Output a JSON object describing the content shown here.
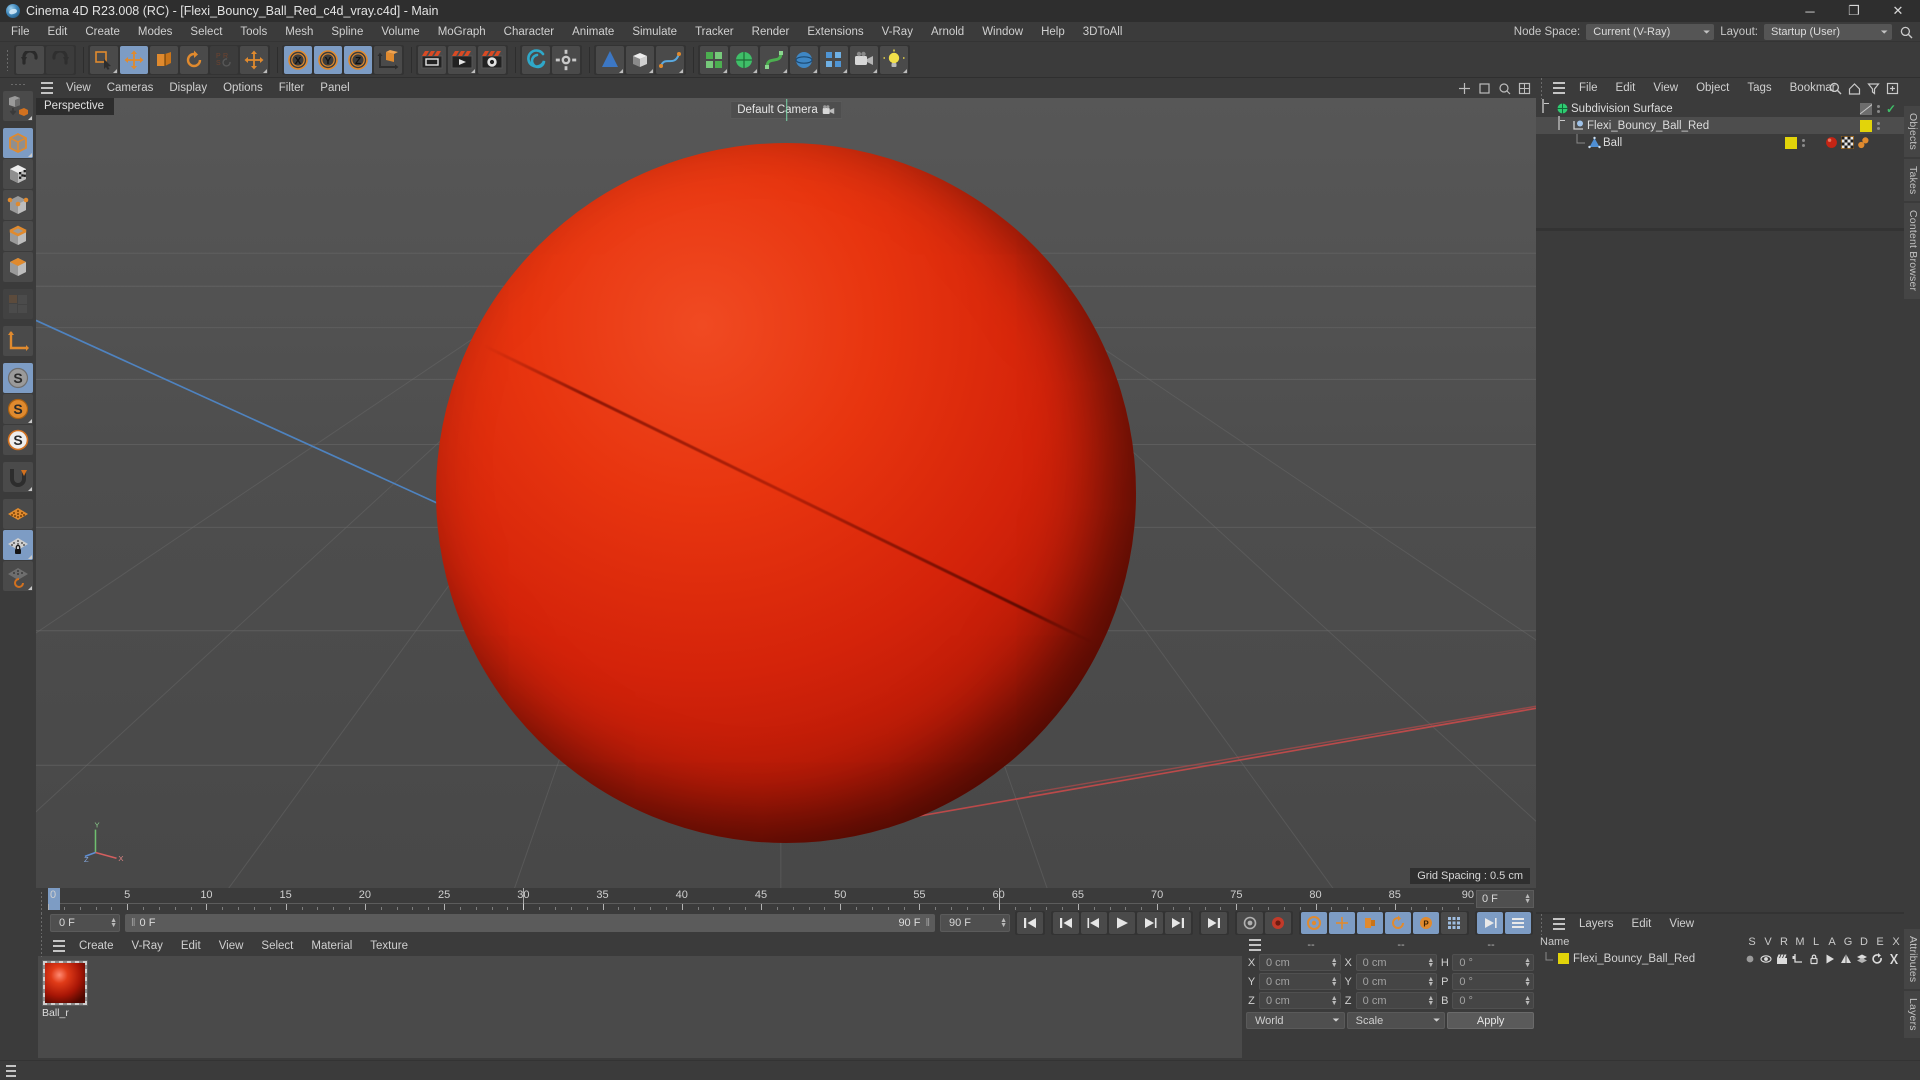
{
  "window": {
    "title": "Cinema 4D R23.008 (RC) - [Flexi_Bouncy_Ball_Red_c4d_vray.c4d] - Main",
    "minimize": "─",
    "maximize": "❐",
    "close": "✕"
  },
  "menubar": {
    "items": [
      "File",
      "Edit",
      "Create",
      "Modes",
      "Select",
      "Tools",
      "Mesh",
      "Spline",
      "Volume",
      "MoGraph",
      "Character",
      "Animate",
      "Simulate",
      "Tracker",
      "Render",
      "Extensions",
      "V-Ray",
      "Arnold",
      "Window",
      "Help",
      "3DToAll"
    ],
    "node_space_label": "Node Space:",
    "node_space_value": "Current (V-Ray)",
    "layout_label": "Layout:",
    "layout_value": "Startup (User)",
    "search_icon": "search-icon"
  },
  "toolbar": {
    "groups": [
      {
        "buttons": [
          {
            "name": "undo-button",
            "icon": "undo-arrow",
            "state": "normal"
          },
          {
            "name": "redo-button",
            "icon": "redo-arrow",
            "state": "disabled"
          }
        ]
      },
      {
        "buttons": [
          {
            "name": "live-selection-button",
            "icon": "selection-cursor",
            "state": "normal"
          },
          {
            "name": "move-tool-button",
            "icon": "move-axis",
            "state": "active"
          },
          {
            "name": "scale-tool-button",
            "icon": "scale-box",
            "state": "normal"
          },
          {
            "name": "rotate-tool-button",
            "icon": "rotate-ring",
            "state": "normal"
          },
          {
            "name": "psr-button",
            "icon": "psr-text",
            "state": "disabled"
          },
          {
            "name": "move-alt-button",
            "icon": "move-axis",
            "state": "normal"
          }
        ]
      },
      {
        "buttons": [
          {
            "name": "x-axis-lock-button",
            "icon": "axis-x",
            "state": "active"
          },
          {
            "name": "y-axis-lock-button",
            "icon": "axis-y",
            "state": "active"
          },
          {
            "name": "z-axis-lock-button",
            "icon": "axis-z",
            "state": "active"
          },
          {
            "name": "world-object-axis-button",
            "icon": "world-cube",
            "state": "normal"
          }
        ]
      },
      {
        "buttons": [
          {
            "name": "render-view-button",
            "icon": "render-clapper",
            "state": "normal"
          },
          {
            "name": "render-to-picture-viewer-button",
            "icon": "render-play-clapper",
            "state": "normal"
          },
          {
            "name": "render-settings-button",
            "icon": "render-gear-clapper",
            "state": "normal"
          }
        ]
      },
      {
        "buttons": [
          {
            "name": "vray-render-button",
            "icon": "vray-swirl",
            "state": "normal"
          },
          {
            "name": "vray-settings-button",
            "icon": "vray-gear",
            "state": "normal"
          }
        ]
      },
      {
        "buttons": [
          {
            "name": "add-primitive-button",
            "icon": "cone-primitive",
            "state": "normal"
          },
          {
            "name": "add-cube-button",
            "icon": "cube-primitive",
            "state": "normal"
          },
          {
            "name": "add-spline-button",
            "icon": "spline-pen",
            "state": "normal"
          }
        ]
      },
      {
        "buttons": [
          {
            "name": "generator-button",
            "icon": "green-array",
            "state": "normal"
          },
          {
            "name": "subdivision-surface-button",
            "icon": "green-subdiv",
            "state": "normal"
          },
          {
            "name": "deformer-button",
            "icon": "green-deformer",
            "state": "normal"
          },
          {
            "name": "scene-object-button",
            "icon": "blue-scene",
            "state": "normal"
          },
          {
            "name": "mograph-button",
            "icon": "blue-mograph",
            "state": "normal"
          },
          {
            "name": "camera-button",
            "icon": "camera",
            "state": "normal"
          },
          {
            "name": "light-button",
            "icon": "light-bulb",
            "state": "normal"
          }
        ]
      }
    ]
  },
  "left_toolbar": {
    "buttons": [
      {
        "name": "make-editable-button",
        "icon": "make-editable",
        "state": "normal"
      },
      {
        "name": "model-mode-button",
        "icon": "model-cube",
        "state": "active"
      },
      {
        "name": "texture-mode-button",
        "icon": "texture-cube",
        "state": "normal"
      },
      {
        "name": "points-mode-button",
        "icon": "points-cube",
        "state": "normal"
      },
      {
        "name": "edges-mode-button",
        "icon": "edges-cube",
        "state": "normal"
      },
      {
        "name": "polygons-mode-button",
        "icon": "polygons-cube",
        "state": "normal"
      },
      {
        "name": "uv-mode-button",
        "icon": "uv-grid",
        "state": "disabled"
      },
      {
        "name": "axis-modify-button",
        "icon": "axis-arrow",
        "state": "normal"
      },
      {
        "name": "enable-snap-button",
        "icon": "snap-s-gray",
        "state": "active"
      },
      {
        "name": "snap-settings-button",
        "icon": "snap-s-orange",
        "state": "normal"
      },
      {
        "name": "quantize-button",
        "icon": "snap-s-white",
        "state": "normal"
      },
      {
        "name": "magnet-button",
        "icon": "magnet",
        "state": "normal"
      },
      {
        "name": "workplane-button",
        "icon": "workplane-grid",
        "state": "normal"
      },
      {
        "name": "lock-workplane-button",
        "icon": "workplane-lock",
        "state": "active"
      },
      {
        "name": "planar-workplane-button",
        "icon": "workplane-rotate",
        "state": "normal"
      }
    ]
  },
  "viewport": {
    "menu": [
      "View",
      "Cameras",
      "Display",
      "Options",
      "Filter",
      "Panel"
    ],
    "label": "Perspective",
    "camera_label": "Default Camera",
    "camera_icon": "camera-icon",
    "grid_spacing": "Grid Spacing : 0.5 cm",
    "axis": {
      "x": "X",
      "y": "Y",
      "z": "Z"
    },
    "ball_color": "#e0320e"
  },
  "timeline": {
    "ticks": [
      0,
      5,
      10,
      15,
      20,
      25,
      30,
      35,
      40,
      45,
      50,
      55,
      60,
      65,
      70,
      75,
      80,
      85,
      90
    ],
    "min": 0,
    "max": 90,
    "current_frame_field": "0 F",
    "playhead_frame": 0,
    "markers": [
      30,
      60,
      90
    ]
  },
  "playback": {
    "current_frame": "0 F",
    "preview_range_start": "0 F",
    "preview_range_end": "90 F",
    "end_frame": "90 F",
    "buttons": [
      {
        "name": "go-to-start-button",
        "icon": "skip-start"
      },
      {
        "name": "go-to-previous-key-button",
        "icon": "prev-key"
      },
      {
        "name": "go-to-previous-frame-button",
        "icon": "step-back"
      },
      {
        "name": "play-button",
        "icon": "play"
      },
      {
        "name": "go-to-next-frame-button",
        "icon": "step-forward"
      },
      {
        "name": "go-to-next-key-button",
        "icon": "next-key"
      },
      {
        "name": "go-to-end-button",
        "icon": "skip-end"
      },
      {
        "name": "record-active-objects-button",
        "icon": "record-dot"
      },
      {
        "name": "autokeying-button",
        "icon": "autokey-circle"
      },
      {
        "name": "keyframe-selection-button",
        "icon": "key-select"
      },
      {
        "name": "position-key-button",
        "icon": "key-position"
      },
      {
        "name": "scale-key-button",
        "icon": "key-scale"
      },
      {
        "name": "rotation-key-button",
        "icon": "key-rotation"
      },
      {
        "name": "param-key-button",
        "icon": "key-param"
      },
      {
        "name": "point-level-animation-button",
        "icon": "key-pla"
      },
      {
        "name": "timeline-view-button",
        "icon": "timeline-blue"
      },
      {
        "name": "motion-view-button",
        "icon": "motion-blue"
      }
    ]
  },
  "material_manager": {
    "menu": [
      "Create",
      "V-Ray",
      "Edit",
      "View",
      "Select",
      "Material",
      "Texture"
    ],
    "materials": [
      {
        "name": "Ball_r",
        "thumbnail": "red-sphere-material"
      }
    ]
  },
  "coordinate_manager": {
    "headers": [
      "--",
      "--",
      "--"
    ],
    "rows": [
      {
        "pos_label": "X",
        "pos_value": "0 cm",
        "size_label": "X",
        "size_value": "0 cm",
        "rot_label": "H",
        "rot_value": "0 °"
      },
      {
        "pos_label": "Y",
        "pos_value": "0 cm",
        "size_label": "Y",
        "size_value": "0 cm",
        "rot_label": "P",
        "rot_value": "0 °"
      },
      {
        "pos_label": "Z",
        "pos_value": "0 cm",
        "size_label": "Z",
        "size_value": "0 cm",
        "rot_label": "B",
        "rot_value": "0 °"
      }
    ],
    "coord_system": "World",
    "transform_mode": "Scale",
    "apply_label": "Apply"
  },
  "object_manager": {
    "menu": [
      "File",
      "Edit",
      "View",
      "Object",
      "Tags",
      "Bookmar"
    ],
    "icons": [
      "search-icon",
      "home-icon",
      "filter-icon",
      "add-icon"
    ],
    "rows": [
      {
        "name": "Subdivision Surface",
        "depth": 0,
        "icon": "subdivision-surface-icon",
        "visdot": "gray",
        "check": true,
        "tags": []
      },
      {
        "name": "Flexi_Bouncy_Ball_Red",
        "depth": 1,
        "icon": "null-object-icon",
        "visdot": "yellow",
        "check": false,
        "tags": []
      },
      {
        "name": "Ball",
        "depth": 2,
        "icon": "polygon-object-icon",
        "visdot": "yellow",
        "check": false,
        "tags": [
          "material-tag",
          "uvw-tag",
          "phong-tag"
        ]
      }
    ]
  },
  "layer_manager": {
    "menu": [
      "Layers",
      "Edit",
      "View"
    ],
    "columns": [
      "S",
      "V",
      "R",
      "M",
      "L",
      "A",
      "G",
      "D",
      "E",
      "X"
    ],
    "name_header": "Name",
    "rows": [
      {
        "name": "Flexi_Bouncy_Ball_Red",
        "color": "#e2d40a"
      }
    ]
  },
  "side_tabs": {
    "right_top": [
      "Objects",
      "Takes",
      "Content Browser"
    ],
    "right_bottom": [
      "Attributes",
      "Layers"
    ]
  }
}
